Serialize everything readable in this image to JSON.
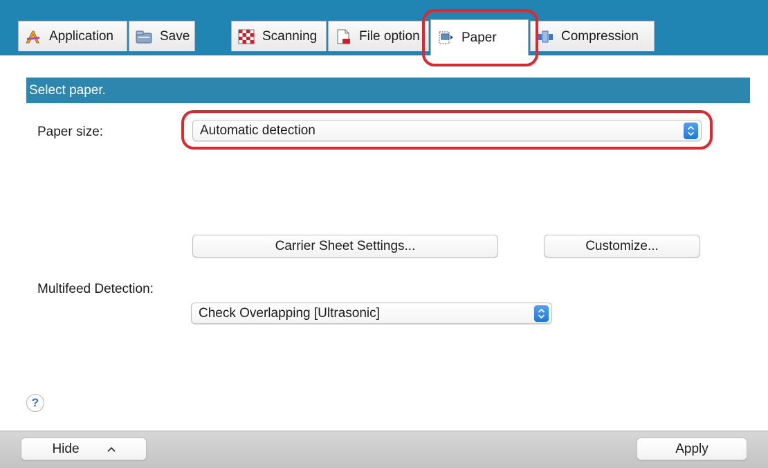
{
  "tabs": [
    {
      "label": "Application",
      "icon": "application-icon"
    },
    {
      "label": "Save",
      "icon": "save-icon"
    },
    {
      "label": "Scanning",
      "icon": "scanning-icon"
    },
    {
      "label": "File option",
      "icon": "file-option-icon"
    },
    {
      "label": "Paper",
      "icon": "paper-icon",
      "selected": true
    },
    {
      "label": "Compression",
      "icon": "compression-icon"
    }
  ],
  "section": {
    "title": "Select paper."
  },
  "paper_size": {
    "label": "Paper size:",
    "value": "Automatic detection"
  },
  "buttons": {
    "carrier_sheet": "Carrier Sheet Settings...",
    "customize": "Customize..."
  },
  "multifeed": {
    "label": "Multifeed Detection:",
    "value": "Check Overlapping [Ultrasonic]"
  },
  "help": {
    "glyph": "?"
  },
  "footer": {
    "hide_label": "Hide",
    "apply_label": "Apply"
  },
  "colors": {
    "header_blue": "#2c86ae",
    "tabstrip_blue": "#2185b4",
    "highlight_red": "#e1262d",
    "popup_blue": "#2375d6"
  }
}
